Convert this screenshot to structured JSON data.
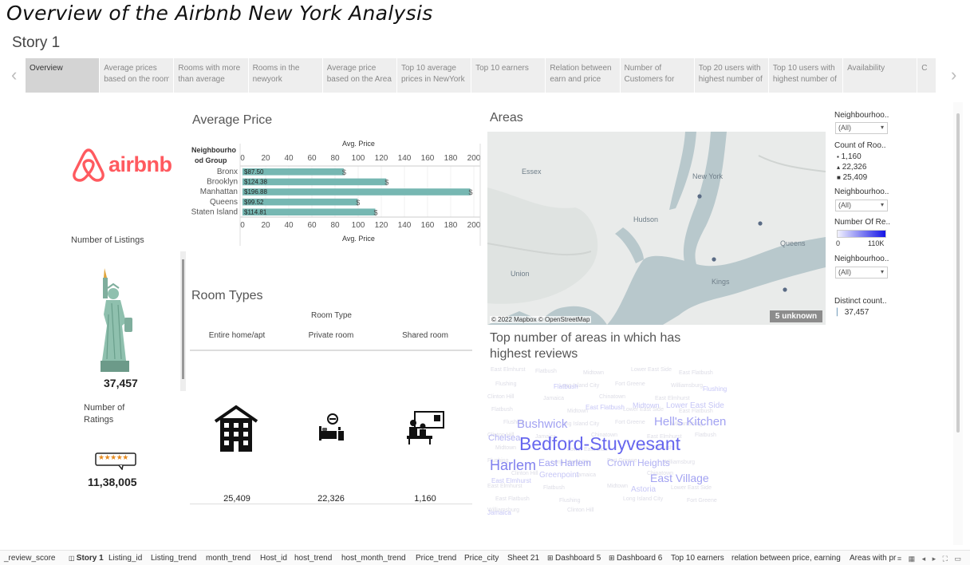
{
  "page_title": "Overview of the Airbnb New York Analysis",
  "story_title": "Story 1",
  "story_points": [
    {
      "l1": "Overview",
      "l2": ""
    },
    {
      "l1": "Average prices",
      "l2": "based on the room"
    },
    {
      "l1": "Rooms with more",
      "l2": "than average"
    },
    {
      "l1": "Rooms in the",
      "l2": "newyork"
    },
    {
      "l1": "Average price",
      "l2": "based on the Area"
    },
    {
      "l1": "Top 10 average",
      "l2": "prices in NewYork"
    },
    {
      "l1": "Top 10 earners",
      "l2": ""
    },
    {
      "l1": "Relation between",
      "l2": "earn and price"
    },
    {
      "l1": "Number of",
      "l2": "Customers for"
    },
    {
      "l1": "Top 20 users with",
      "l2": "highest number of"
    },
    {
      "l1": "Top 10 users with",
      "l2": "highest number of"
    },
    {
      "l1": "Availability",
      "l2": ""
    },
    {
      "l1": "C",
      "l2": ""
    }
  ],
  "nav": {
    "prev": "‹",
    "next": "›"
  },
  "logo": {
    "word": "airbnb",
    "color": "#ff5a5f"
  },
  "listings": {
    "label": "Number of Listings",
    "value": "37,457"
  },
  "ratings": {
    "label1": "Number of",
    "label2": "Ratings",
    "value": "11,38,005",
    "stars": "★★★★★"
  },
  "chart_data": {
    "type": "bar",
    "title": "Average Price",
    "xlabel": "Avg. Price",
    "ylabel_line1": "Neighbourho",
    "ylabel_line2": "od Group",
    "categories": [
      "Bronx",
      "Brooklyn",
      "Manhattan",
      "Queens",
      "Staten Island"
    ],
    "values": [
      87.5,
      124.38,
      196.88,
      99.52,
      114.81
    ],
    "labels": [
      "$87.50",
      "$124.38",
      "$196.88",
      "$99.52",
      "$114.81"
    ],
    "xlim": [
      0,
      200
    ],
    "ticks": [
      "0",
      "20",
      "40",
      "60",
      "80",
      "100",
      "120",
      "140",
      "160",
      "180",
      "200"
    ],
    "bar_color": "#76b7b2",
    "marker": "$"
  },
  "room_types": {
    "title": "Room Types",
    "header": "Room Type",
    "items": [
      {
        "name": "Entire home/apt",
        "count": "25,409",
        "icon": "building-icon"
      },
      {
        "name": "Private room",
        "count": "22,326",
        "icon": "private-room-icon"
      },
      {
        "name": "Shared room",
        "count": "1,160",
        "icon": "shared-room-icon"
      }
    ]
  },
  "map": {
    "title": "Areas",
    "attribution": "© 2022 Mapbox © OpenStreetMap",
    "unknown": "5 unknown",
    "labels": [
      "Essex",
      "New York",
      "Hudson",
      "Queens",
      "Union",
      "Kings"
    ]
  },
  "wordcloud": {
    "title_l1": "Top number of areas in which has",
    "title_l2": "highest reviews",
    "words": [
      "Bushwick",
      "Hell's Kitchen",
      "Chelsea",
      "Bedford-Stuyvesant",
      "Harlem",
      "East Harlem",
      "Crown Heights",
      "East Village",
      "Greenpoint",
      "Astoria",
      "East Elmhurst",
      "Flatbush",
      "Midtown",
      "Lower East Side",
      "East Flatbush",
      "Flushing",
      "Long Island City",
      "Fort Greene",
      "Williamsburg",
      "Clinton Hill",
      "Jamaica",
      "Chinatown"
    ]
  },
  "filters": {
    "f1_label": "Neighbourhoo..",
    "f1_value": "(All)",
    "count_label": "Count of Roo..",
    "count_values": [
      "1,160",
      "22,326",
      "25,409"
    ],
    "f2_label": "Neighbourhoo..",
    "f2_value": "(All)",
    "reviews_label": "Number Of Re..",
    "reviews_min": "0",
    "reviews_max": "110K",
    "f3_label": "Neighbourhoo..",
    "f3_value": "(All)",
    "distinct_label": "Distinct count..",
    "distinct_value": "37,457"
  },
  "sheet_tabs": [
    "_review_score",
    "Story 1",
    "Listing_id",
    "Listing_trend",
    "month_trend",
    "Host_id",
    "host_trend",
    "host_month_trend",
    "Price_trend",
    "Price_city",
    "Sheet 21",
    "Dashboard 5",
    "Dashboard 6",
    "Top 10 earners",
    "relation between price, earning",
    "Areas with pr"
  ],
  "bottom_nav": "≡ ▦ ◂ ▸ ⛶ ▭",
  "colors": {
    "map_land": "#e9ebea",
    "map_water": "#b8c8cc",
    "wordcloud": "#8b8bf0"
  }
}
